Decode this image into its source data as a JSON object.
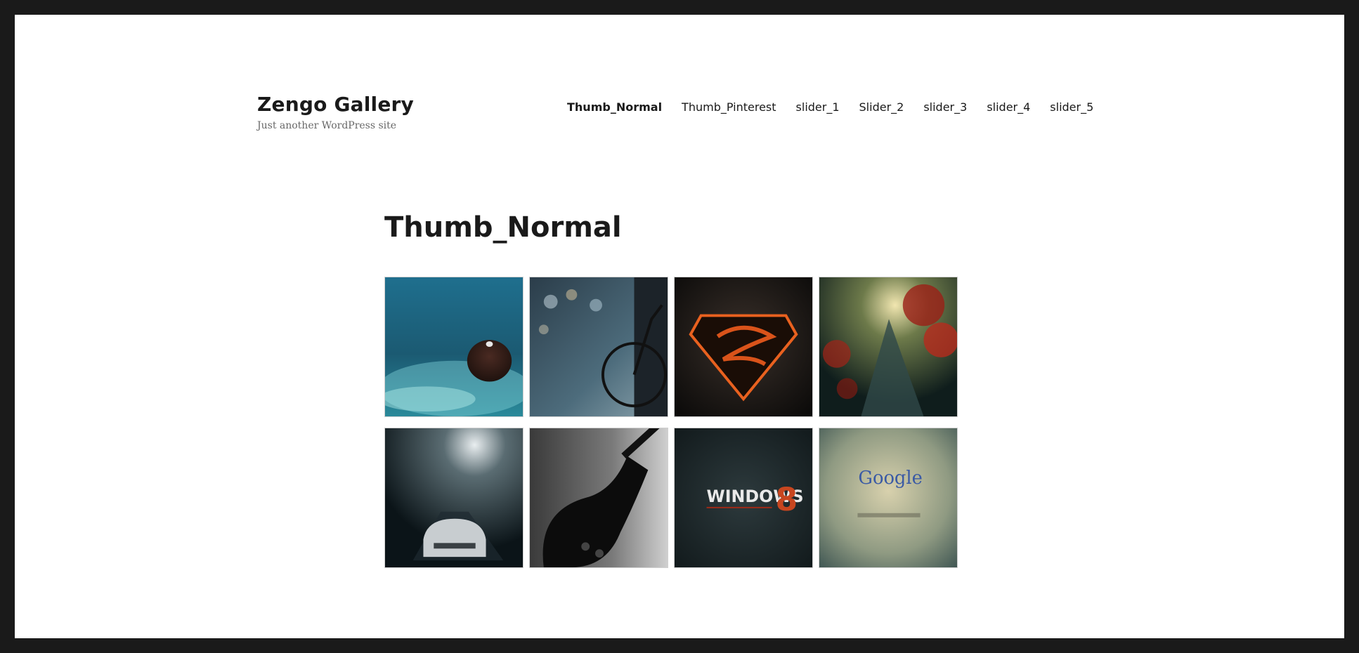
{
  "site": {
    "title": "Zengo Gallery",
    "description": "Just another WordPress site"
  },
  "nav": {
    "items": [
      {
        "label": "Thumb_Normal",
        "active": true
      },
      {
        "label": "Thumb_Pinterest"
      },
      {
        "label": "slider_1"
      },
      {
        "label": "Slider_2"
      },
      {
        "label": "slider_3"
      },
      {
        "label": "slider_4"
      },
      {
        "label": "slider_5"
      }
    ]
  },
  "main": {
    "page_title": "Thumb_Normal",
    "thumbnails": [
      {
        "subject": "blue-cupcake-bokeh"
      },
      {
        "subject": "bicycle-street-bokeh"
      },
      {
        "subject": "burning-superman-logo"
      },
      {
        "subject": "red-forest-path"
      },
      {
        "subject": "car-in-misty-night"
      },
      {
        "subject": "black-electric-guitar"
      },
      {
        "subject": "windows-8-logo",
        "text": "WINDOWS",
        "text2": "8"
      },
      {
        "subject": "google-logo-grunge",
        "text": "Google"
      }
    ]
  },
  "colors": {
    "frame": "#1a1a1a",
    "page": "#ffffff",
    "text": "#1a1a1a",
    "muted": "#686868"
  }
}
